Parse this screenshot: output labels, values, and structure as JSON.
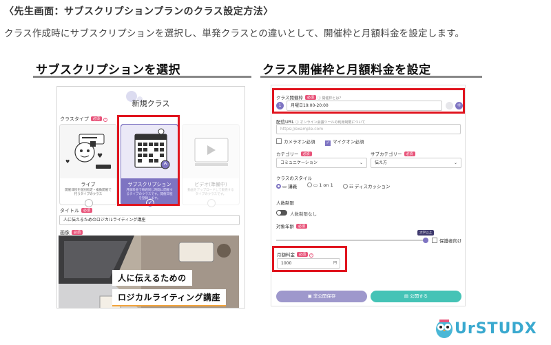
{
  "header": {
    "title": "〈先生画面：サブスクリプションプランのクラス設定方法〉",
    "description": "クラス作成時にサブスクリプションを選択し、単発クラスとの違いとして、開催枠と月額料金を設定します。"
  },
  "sections": {
    "left_heading": "サブスクリプションを選択",
    "right_heading": "クラス開催枠と月額料金を設定"
  },
  "left_screen": {
    "modal_title": "新規クラス",
    "class_type_label": "クラスタイプ",
    "required_badge": "必須",
    "cards": [
      {
        "name": "ライブ",
        "desc": "開催日程を個別指定・複数開催で行うタイプのクラス"
      },
      {
        "name": "サブスクリプション",
        "desc": "月額料金で毎週同じ時間に開催するタイプのクラスです。開催日程を登録します。"
      },
      {
        "name": "ビデオ(準備中)",
        "desc": "動画をアップロードして販売するタイプのクラスです。"
      }
    ],
    "title_label": "タイトル",
    "title_value": "人に伝えるためのロジカルライティング講座",
    "image_label": "画像",
    "banner_line1": "人に伝えるための",
    "banner_line2": "ロジカルライティング講座"
  },
  "right_screen": {
    "slot_label": "クラス開催枠",
    "required_badge": "必須",
    "slot_help": "ⓘ 開催枠とは?",
    "slot_index": "1",
    "slot_value": "月曜日19:00-20:00",
    "delivery_label": "配信URL",
    "delivery_help": "ⓘ オンライン会議ツールの利用制限について",
    "delivery_placeholder": "https://example.com",
    "camera_label": "カメラオン必須",
    "mic_label": "マイクオン必須",
    "category_label": "カテゴリー",
    "category_value": "コミュニケーション",
    "subcategory_label": "サブカテゴリー",
    "subcategory_value": "伝え方",
    "style_label": "クラスのスタイル",
    "styles": [
      "講義",
      "1 on 1",
      "ディスカッション"
    ],
    "capacity_label": "人数制限",
    "capacity_value": "人数制限なし",
    "age_label": "対象年齢",
    "age_tip": "大学以上",
    "guardian_label": "保護者向け",
    "fee_label": "月額料金",
    "fee_value": "1000",
    "fee_unit": "円",
    "save_label": "非公開保存",
    "publish_label": "公開する"
  },
  "logo": {
    "text": "UrSTUDX"
  },
  "colors": {
    "accent": "#7e74c2",
    "highlight": "#e0141e",
    "teal": "#45c3b6",
    "required": "#e8547a"
  }
}
